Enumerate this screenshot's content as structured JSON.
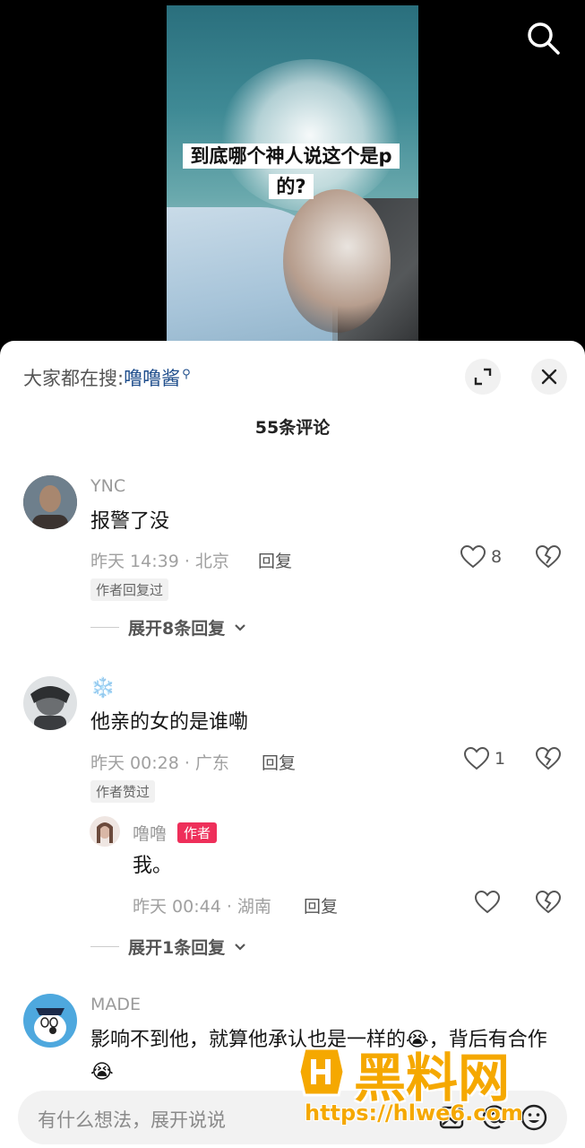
{
  "video": {
    "caption": "到底哪个神人说这个是p的?"
  },
  "header": {
    "search_prefix": "大家都在搜:",
    "search_keyword": "噜噜酱",
    "comment_count": "55条评论"
  },
  "comments": [
    {
      "username": "YNC",
      "text": "报警了没",
      "meta": "昨天 14:39 · 北京",
      "reply_label": "回复",
      "likes": "8",
      "tag": "作者回复过",
      "expand_label": "展开8条回复"
    },
    {
      "username": "❄️",
      "text": "他亲的女的是谁嘞",
      "meta": "昨天 00:28 · 广东",
      "reply_label": "回复",
      "likes": "1",
      "tag": "作者赞过",
      "reply": {
        "username": "噜噜",
        "badge": "作者",
        "text": "我。",
        "meta": "昨天 00:44 · 湖南",
        "reply_label": "回复"
      },
      "expand_label": "展开1条回复"
    },
    {
      "username": "MADE",
      "text": "影响不到他，就算他承认也是一样的😭，背后有合作😭"
    }
  ],
  "input": {
    "placeholder": "有什么想法，展开说说"
  },
  "watermark": {
    "text": "黑料网",
    "url": "https://hlwe6.com"
  },
  "icons": {
    "search": "search-icon",
    "expand": "expand-icon",
    "close": "close-icon",
    "like": "heart-icon",
    "dislike": "broken-heart-icon",
    "image": "image-icon",
    "mention": "at-icon",
    "emoji": "emoji-icon"
  }
}
